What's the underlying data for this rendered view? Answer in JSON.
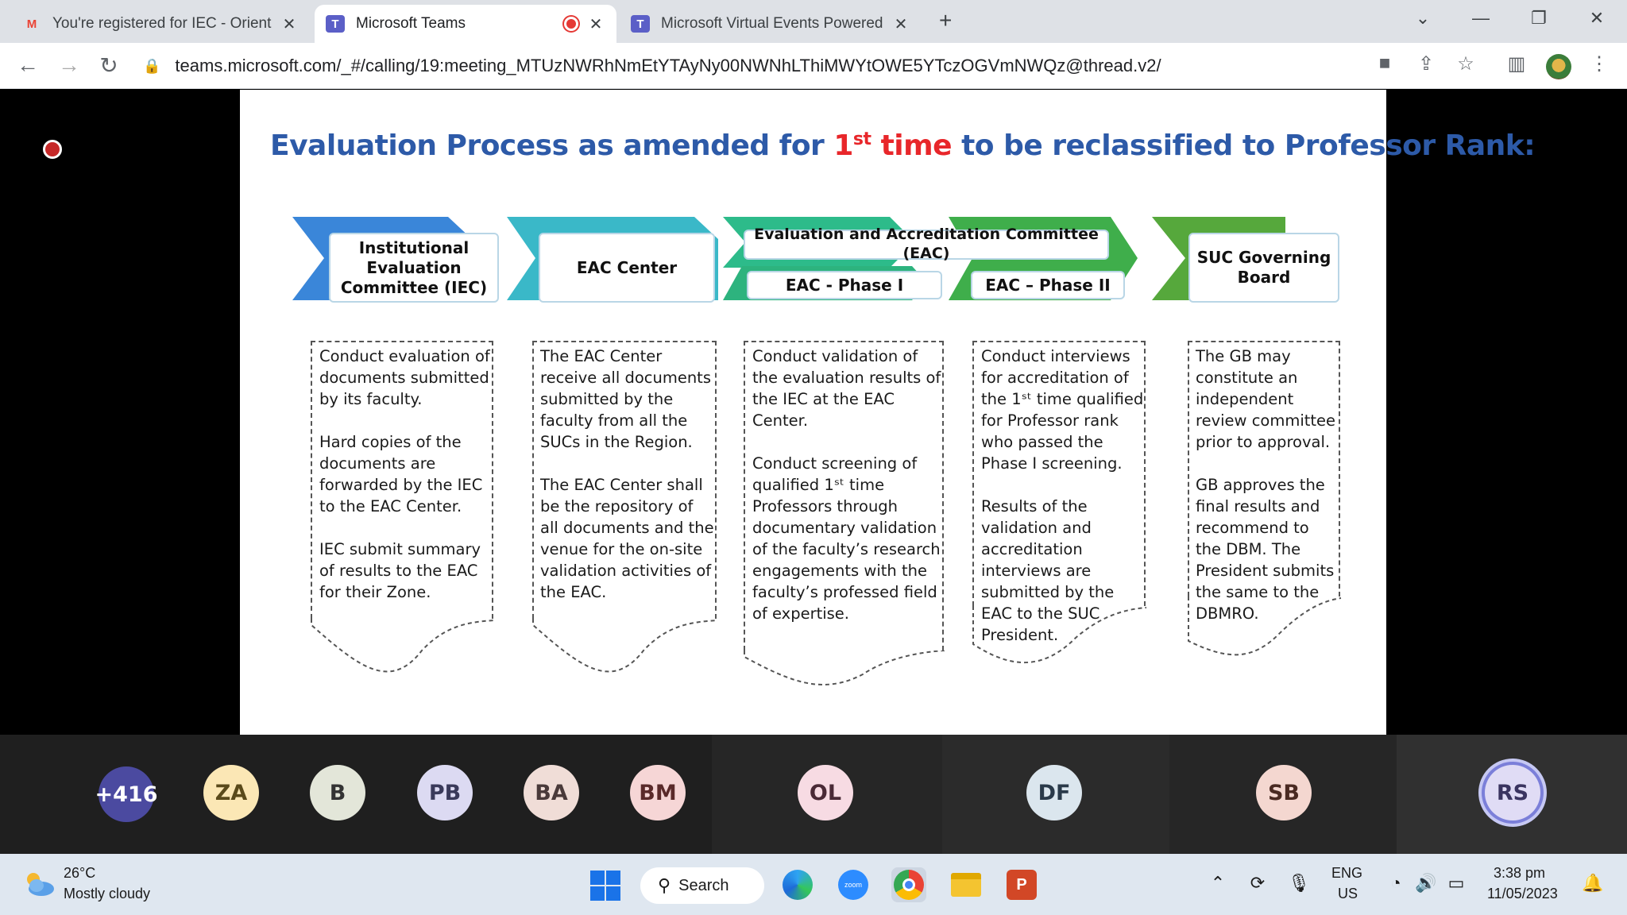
{
  "browser": {
    "tabs": [
      {
        "title": "You're registered for IEC - Orient",
        "icon": "gmail-icon",
        "active": false
      },
      {
        "title": "Microsoft Teams",
        "icon": "teams-icon",
        "active": true,
        "recording": true
      },
      {
        "title": "Microsoft Virtual Events Powered",
        "icon": "teams-icon",
        "active": false
      }
    ],
    "url": "teams.microsoft.com/_#/calling/19:meeting_MTUzNWRhNmEtYTAyNy00NWNhLThiMWYtOWE5YTczOGVmNWQz@thread.v2/"
  },
  "slide": {
    "title_part1": "Evaluation Process as amended for ",
    "title_num": "1",
    "title_sup": "st",
    "title_time": " time",
    "title_part2": " to be reclassified to Professor Rank:",
    "stages": [
      {
        "label": "Institutional Evaluation Committee (IEC)",
        "color": "#3a86d9"
      },
      {
        "label": "EAC Center",
        "color": "#3ab8c8"
      },
      {
        "label": "EAC - Phase I",
        "color": "#2dbb8a"
      },
      {
        "label": "EAC – Phase II",
        "color": "#3fae4b"
      },
      {
        "label": "SUC Governing Board",
        "color": "#56a83c"
      }
    ],
    "eac_header": "Evaluation and Accreditation Committee (EAC)",
    "docs": [
      "Conduct evaluation of\ndocuments submitted\nby its faculty.\n\nHard copies of the\ndocuments are\nforwarded by the IEC\nto the EAC Center.\n\nIEC submit summary\nof results to the EAC\nfor their Zone.",
      "The EAC Center\nreceive all documents\nsubmitted by the\nfaculty from all the\nSUCs in the Region.\n\nThe EAC Center shall\nbe the repository of\nall documents and the\nvenue for the on-site\nvalidation activities of\nthe EAC.",
      "Conduct validation of\nthe evaluation results of\nthe IEC at the EAC\nCenter.\n\nConduct screening of\nqualified 1ˢᵗ time\nProfessors through\ndocumentary validation\nof the faculty’s research\nengagements with the\nfaculty’s professed field\nof expertise.",
      "Conduct interviews\nfor accreditation of\nthe 1ˢᵗ time qualified\nfor Professor rank\nwho passed the\nPhase I screening.\n\nResults of the\nvalidation and\naccreditation\ninterviews are\nsubmitted by the\nEAC to the SUC\nPresident.",
      "The GB may\nconstitute an\nindependent\nreview committee\nprior to approval.\n\nGB approves the\nfinal results and\nrecommend to\nthe DBM. The\nPresident submits\nthe same to the\nDBMRO."
    ]
  },
  "participants": [
    {
      "initials": "+416",
      "bg": "#4b4aa0",
      "fg": "#ffffff"
    },
    {
      "initials": "ZA",
      "bg": "#fbe7b5",
      "fg": "#5a4a1a"
    },
    {
      "initials": "B",
      "bg": "#e3e6d9",
      "fg": "#333333"
    },
    {
      "initials": "PB",
      "bg": "#dcdaf2",
      "fg": "#3a3a5a"
    },
    {
      "initials": "BA",
      "bg": "#f0ddd7",
      "fg": "#4a3a3a"
    },
    {
      "initials": "BM",
      "bg": "#f6d6d6",
      "fg": "#5a2a2a"
    },
    {
      "initials": "OL",
      "bg": "#f7dbe3",
      "fg": "#4a2a36"
    },
    {
      "initials": "DF",
      "bg": "#dbe6ee",
      "fg": "#2a3a4a"
    },
    {
      "initials": "SB",
      "bg": "#f4d7d0",
      "fg": "#4a2a22"
    },
    {
      "initials": "RS",
      "bg": "#e0dcf5",
      "fg": "#3a3460"
    }
  ],
  "taskbar": {
    "temp": "26°C",
    "weather": "Mostly cloudy",
    "search": "Search",
    "lang1": "ENG",
    "lang2": "US",
    "time": "3:38 pm",
    "date": "11/05/2023"
  }
}
